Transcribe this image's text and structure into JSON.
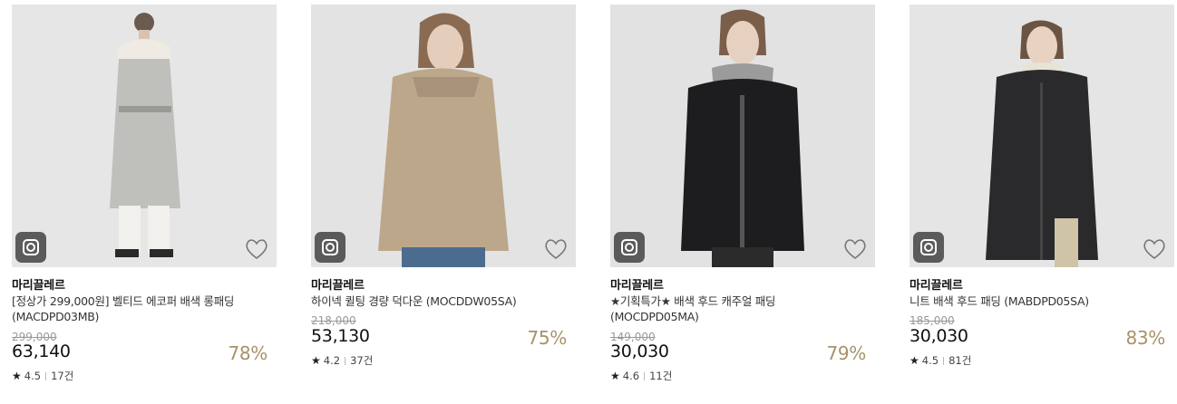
{
  "colors": {
    "accent": "#a89269",
    "photo_bg": "#e4e4e4"
  },
  "icons": {
    "camera": "camera-icon",
    "wishlist": "heart-icon",
    "rating": "star-icon"
  },
  "products": [
    {
      "brand": "마리끌레르",
      "title": "[정상가 299,000원] 벨티드 에코퍼 배색 롱패딩 (MACDPD03MB)",
      "original_price": "299,000",
      "price": "63,140",
      "discount": "78%",
      "star": "★",
      "rating": "4.5",
      "reviews": "17건"
    },
    {
      "brand": "마리끌레르",
      "title": "하이넥 퀼팅 경량 덕다운 (MOCDDW05SA)",
      "original_price": "218,000",
      "price": "53,130",
      "discount": "75%",
      "star": "★",
      "rating": "4.2",
      "reviews": "37건"
    },
    {
      "brand": "마리끌레르",
      "title": "★기획특가★ 배색 후드 캐주얼 패딩 (MOCDPD05MA)",
      "original_price": "149,000",
      "price": "30,030",
      "discount": "79%",
      "star": "★",
      "rating": "4.6",
      "reviews": "11건"
    },
    {
      "brand": "마리끌레르",
      "title": "니트 배색 후드 패딩 (MABDPD05SA)",
      "original_price": "185,000",
      "price": "30,030",
      "discount": "83%",
      "star": "★",
      "rating": "4.5",
      "reviews": "81건"
    }
  ]
}
